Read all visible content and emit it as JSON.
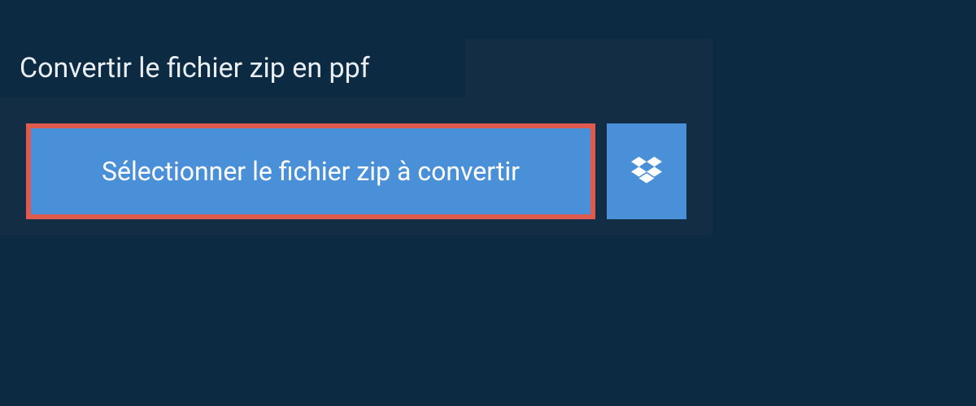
{
  "header": {
    "title": "Convertir le fichier zip en ppf"
  },
  "actions": {
    "select_file_label": "Sélectionner le fichier zip à convertir"
  },
  "icons": {
    "dropbox": "dropbox"
  },
  "colors": {
    "background_dark": "#0c2a42",
    "panel": "#122d44",
    "button": "#4990d8",
    "highlight_border": "#df5a4e",
    "text": "#ffffff"
  }
}
